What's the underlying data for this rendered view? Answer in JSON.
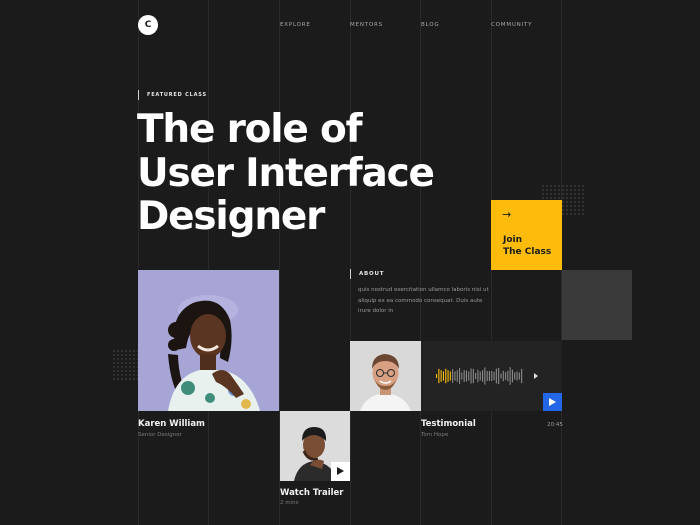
{
  "logo": {
    "letter": "C"
  },
  "nav": {
    "items": [
      {
        "label": "EXPLORE"
      },
      {
        "label": "MENTORS"
      },
      {
        "label": "BLOG"
      },
      {
        "label": "COMMUNITY"
      }
    ]
  },
  "hero": {
    "eyebrow": "FEATURED CLASS",
    "title_lines": [
      "The role of",
      "User Interface",
      "Designer"
    ]
  },
  "cta": {
    "arrow": "→",
    "label_line1": "Join",
    "label_line2": "The Class"
  },
  "about": {
    "heading": "ABOUT",
    "body": "quis nostrud exercitation ullamco laboris nisi ut aliquip ex ea commodo consequat. Duis aute irure dolor in"
  },
  "mentor": {
    "name": "Karen William",
    "role": "Senior Designer"
  },
  "trailer": {
    "title": "Watch Trailer",
    "duration": "2 mins"
  },
  "testimonial": {
    "title": "Testimonial",
    "author": "Tom Hope",
    "duration": "20:45"
  },
  "colors": {
    "accent": "#fdbb0c",
    "play": "#2466e8",
    "background": "#1b1b1b"
  }
}
